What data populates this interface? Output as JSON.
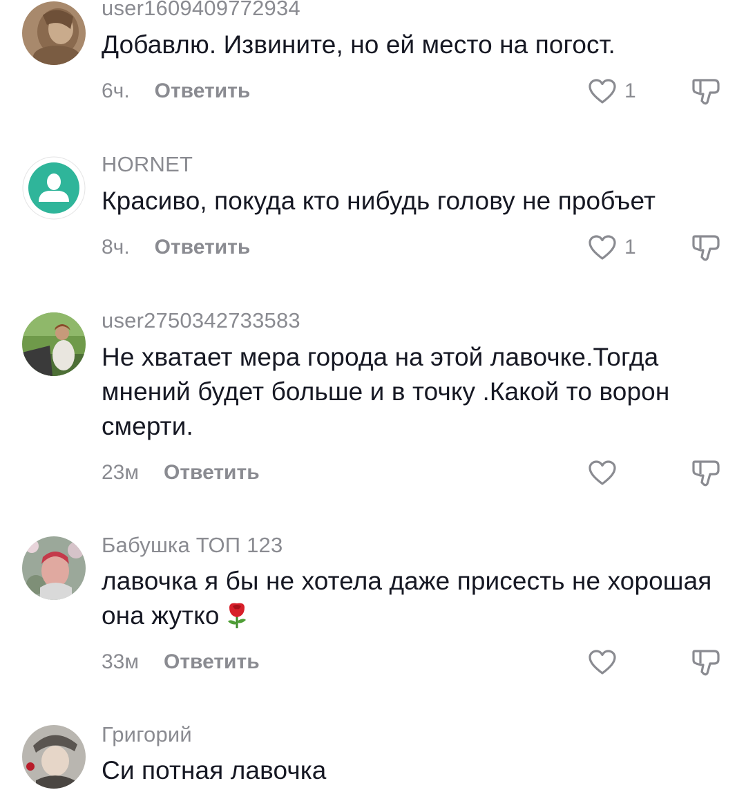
{
  "comments": [
    {
      "username": "user1609409772934",
      "text": "Добавлю. Извините, но ей место на погост.",
      "time": "6ч.",
      "reply_label": "Ответить",
      "likes": "1"
    },
    {
      "username": "HORNET",
      "text": "Красиво, покуда кто нибудь голову не пробъет",
      "time": "8ч.",
      "reply_label": "Ответить",
      "likes": "1"
    },
    {
      "username": "user2750342733583",
      "text": "Не хватает мера города на этой лавочке.Тогда мнений будет больше и в точку .Какой то ворон смерти.",
      "time": "23м",
      "reply_label": "Ответить",
      "likes": ""
    },
    {
      "username": "Бабушка ТОП 123",
      "text": "лавочка я бы не хотела даже присесть не хорошая она жутко",
      "emoji": "rose",
      "time": "33м",
      "reply_label": "Ответить",
      "likes": ""
    },
    {
      "username": "Григорий",
      "text": "Си потная лавочка"
    }
  ],
  "colors": {
    "text": "#161823",
    "muted": "#8a8b91",
    "default_avatar_bg": "#2fb59a"
  }
}
